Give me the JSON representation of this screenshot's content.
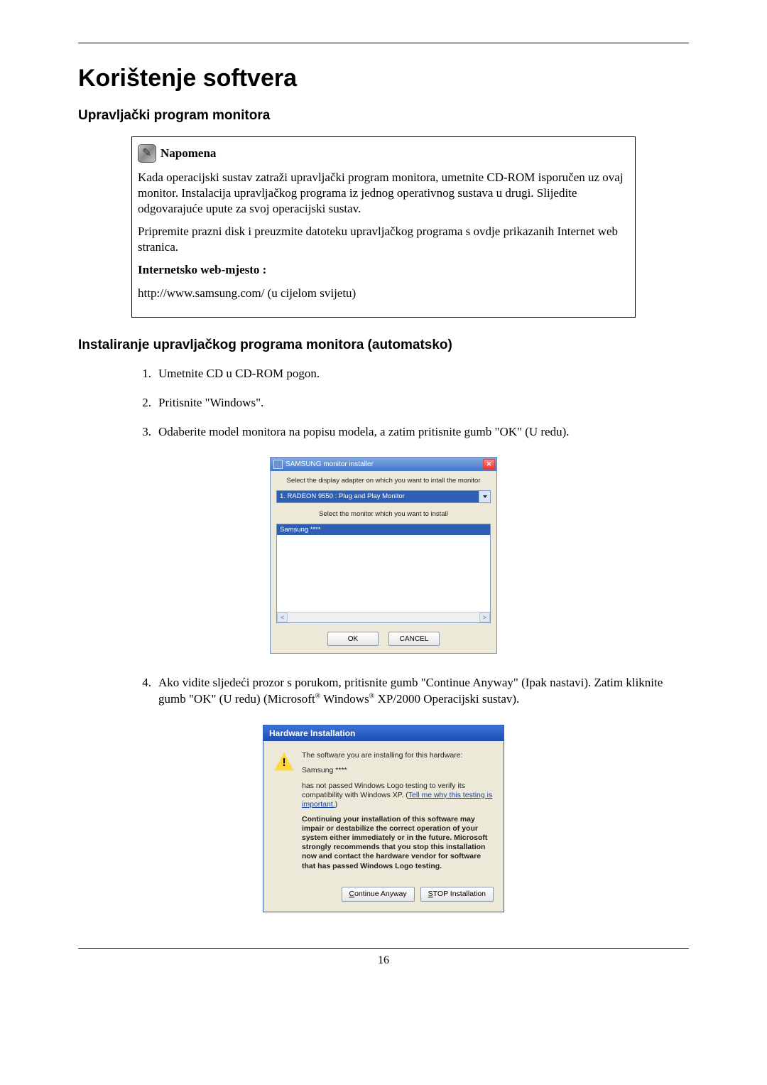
{
  "page": {
    "title": "Korištenje softvera",
    "section1_title": "Upravljački program monitora",
    "section2_title": "Instaliranje upravljačkog programa monitora (automatsko)",
    "page_number": "16"
  },
  "note": {
    "label": "Napomena",
    "p1": "Kada operacijski sustav zatraži upravljački program monitora, umetnite CD-ROM isporučen uz ovaj monitor. Instalacija upravljačkog programa iz jednog operativnog sustava u drugi. Slijedite odgovarajuće upute za svoj operacijski sustav.",
    "p2": "Pripremite prazni disk i preuzmite datoteku upravljačkog programa s ovdje prikazanih Internet web stranica.",
    "website_label": "Internetsko web-mjesto :",
    "website_url": "http://www.samsung.com/ (u cijelom svijetu)"
  },
  "steps": {
    "s1": "Umetnite CD u CD-ROM pogon.",
    "s2": "Pritisnite \"Windows\".",
    "s3": "Odaberite model monitora na popisu modela, a zatim pritisnite gumb \"OK\" (U redu).",
    "s4_a": "Ako vidite sljedeći prozor s porukom, pritisnite gumb \"Continue Anyway\" (Ipak nastavi). Zatim kliknite gumb \"OK\" (U redu) (Microsoft",
    "s4_b": " Windows",
    "s4_c": " XP/2000 Operacijski sustav)."
  },
  "dlg1": {
    "title": "SAMSUNG monitor installer",
    "label1": "Select the display adapter on which you want to intall the monitor",
    "combo_value": "1. RADEON 9550 : Plug and Play Monitor",
    "label2": "Select the monitor which you want to install",
    "list_selected": "Samsung ****",
    "ok": "OK",
    "cancel": "CANCEL"
  },
  "dlg2": {
    "title": "Hardware Installation",
    "p1": "The software you are installing for this hardware:",
    "p2": "Samsung ****",
    "p3_a": "has not passed Windows Logo testing to verify its compatibility with Windows XP. (",
    "p3_link": "Tell me why this testing is important.",
    "p3_b": ")",
    "p4": "Continuing your installation of this software may impair or destabilize the correct operation of your system either immediately or in the future. Microsoft strongly recommends that you stop this installation now and contact the hardware vendor for software that has passed Windows Logo testing.",
    "btn_continue_u": "C",
    "btn_continue_rest": "ontinue Anyway",
    "btn_stop_u": "S",
    "btn_stop_rest": "TOP Installation"
  }
}
